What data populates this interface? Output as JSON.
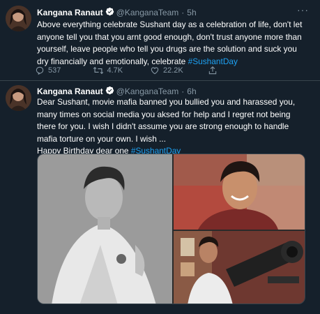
{
  "tweets": [
    {
      "author": "Kangana Ranaut",
      "handle": "@KanganaTeam",
      "sep": "·",
      "time": "5h",
      "text_main": "Above everything celebrate Sushant day as a celebration of life, don't let anyone tell you that you arnt good enough, don't trust anyone more than yourself, leave people who tell you drugs are the solution and suck you dry financially and emotionally, celebrate ",
      "hashtag": "#SushantDay",
      "stats": {
        "replies": "537",
        "retweets": "4.7K",
        "likes": "22.2K"
      }
    },
    {
      "author": "Kangana Ranaut",
      "handle": "@KanganaTeam",
      "sep": "·",
      "time": "6h",
      "text_main": "Dear Sushant, movie mafia banned you bullied you and harassed you, many times on social media you aksed for help and I regret not being there for you. I wish I didn't assume you are strong enough to handle mafia torture on your own. I wish ...",
      "text_line2": "Happy Birthday dear one ",
      "hashtag": "#SushantDay"
    }
  ],
  "colors": {
    "background": "#15202b",
    "text": "#ffffff",
    "muted": "#8899a6",
    "link": "#1da1f2",
    "divider": "#38444d"
  },
  "icons": [
    "more-icon",
    "verified-icon",
    "reply-icon",
    "retweet-icon",
    "like-icon",
    "share-icon"
  ]
}
